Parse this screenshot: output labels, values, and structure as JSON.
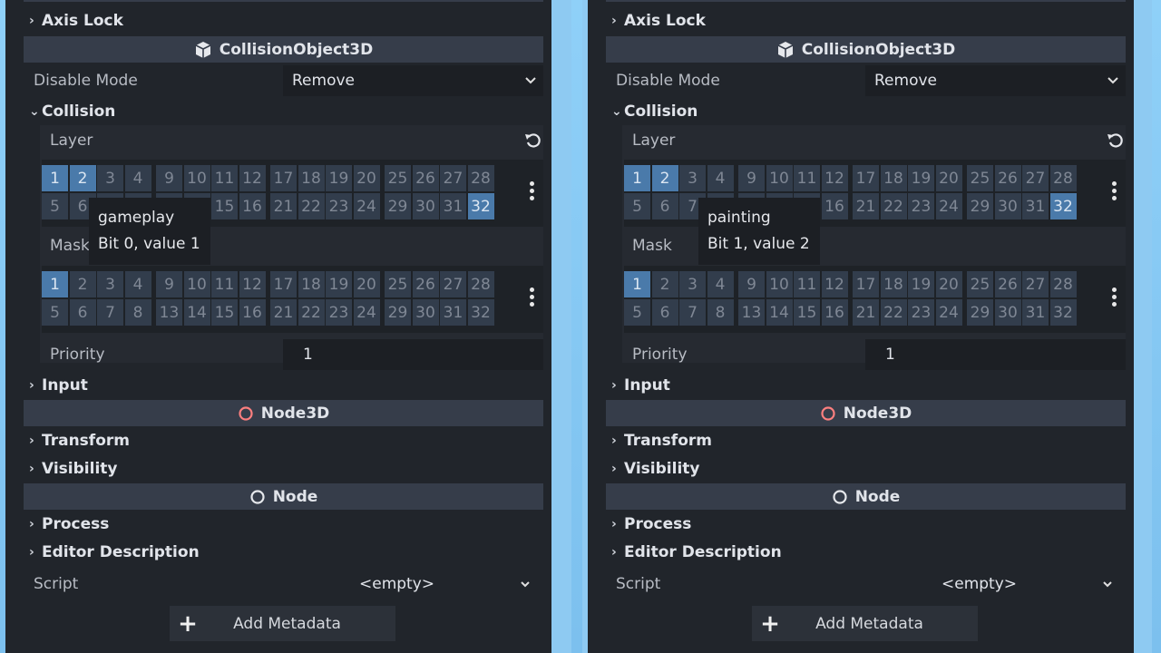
{
  "panels": [
    {
      "axis_lock": "Axis Lock",
      "collision_object": "CollisionObject3D",
      "disable_mode_label": "Disable Mode",
      "disable_mode_value": "Remove",
      "collision": "Collision",
      "layer_label": "Layer",
      "mask_label": "Mask",
      "priority_label": "Priority",
      "priority_value": "1",
      "input": "Input",
      "node3d": "Node3D",
      "transform": "Transform",
      "visibility": "Visibility",
      "node": "Node",
      "process": "Process",
      "editor_description": "Editor Description",
      "script_label": "Script",
      "script_value": "<empty>",
      "add_metadata": "Add Metadata",
      "tooltip_title": "gameplay",
      "tooltip_detail": "Bit 0, value 1",
      "layer_on": [
        1,
        2,
        32
      ],
      "mask_on": [
        1
      ]
    },
    {
      "axis_lock": "Axis Lock",
      "collision_object": "CollisionObject3D",
      "disable_mode_label": "Disable Mode",
      "disable_mode_value": "Remove",
      "collision": "Collision",
      "layer_label": "Layer",
      "mask_label": "Mask",
      "priority_label": "Priority",
      "priority_value": "1",
      "input": "Input",
      "node3d": "Node3D",
      "transform": "Transform",
      "visibility": "Visibility",
      "node": "Node",
      "process": "Process",
      "editor_description": "Editor Description",
      "script_label": "Script",
      "script_value": "<empty>",
      "add_metadata": "Add Metadata",
      "tooltip_title": "painting",
      "tooltip_detail": "Bit 1, value 2",
      "layer_on": [
        1,
        2,
        32
      ],
      "mask_on": [
        1
      ]
    }
  ],
  "colors": {
    "accent": "#4a7aaa",
    "panel_bg": "#21252b",
    "header_bg": "#363d4a",
    "node3d_icon": "#fc7f7f"
  },
  "icons": {
    "collision_object": "cube-icon",
    "node3d": "node3d-circle-icon",
    "node": "node-circle-icon",
    "revert": "revert-icon",
    "dropdown": "chevron-down-icon",
    "menu": "kebab-menu-icon",
    "add": "plus-icon"
  }
}
